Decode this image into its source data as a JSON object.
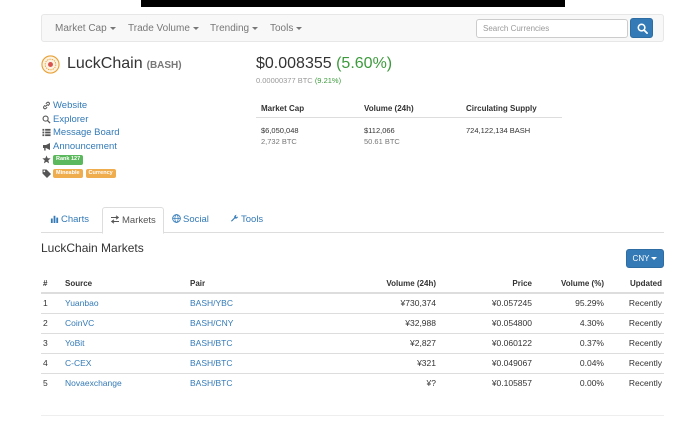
{
  "nav": {
    "items": [
      {
        "label": "Market Cap"
      },
      {
        "label": "Trade Volume"
      },
      {
        "label": "Trending"
      },
      {
        "label": "Tools"
      }
    ],
    "search_placeholder": "Search Currencies",
    "search_icon": "search-icon"
  },
  "coin": {
    "name": "LuckChain",
    "symbol": "(BASH)",
    "logo_icon": "luckchain-logo",
    "price_usd": "$0.008355",
    "change_usd": "(5.60%)",
    "price_btc": "0.00000377 BTC",
    "change_btc": "(9.21%)",
    "change_color": "#3c9a3c"
  },
  "links": {
    "website": "Website",
    "explorer": "Explorer",
    "message_board": "Message Board",
    "announcement": "Announcement",
    "rank": "Rank 127",
    "tags": [
      "Mineable",
      "Currency"
    ]
  },
  "stats": {
    "headers": {
      "market_cap": "Market Cap",
      "volume": "Volume (24h)",
      "supply": "Circulating Supply"
    },
    "market_cap_usd": "$6,050,048",
    "market_cap_btc": "2,732 BTC",
    "volume_usd": "$112,066",
    "volume_btc": "50.61 BTC",
    "supply": "724,122,134 BASH"
  },
  "tabs": [
    {
      "label": "Charts",
      "icon": "bar-chart-icon"
    },
    {
      "label": "Markets",
      "icon": "exchange-arrows-icon",
      "active": true
    },
    {
      "label": "Social",
      "icon": "globe-icon"
    },
    {
      "label": "Tools",
      "icon": "wrench-icon"
    }
  ],
  "markets": {
    "title": "LuckChain Markets",
    "currency": "CNY",
    "columns": [
      "#",
      "Source",
      "Pair",
      "Volume (24h)",
      "Price",
      "Volume (%)",
      "Updated"
    ],
    "rows": [
      [
        "1",
        "Yuanbao",
        "BASH/YBC",
        "¥730,374",
        "¥0.057245",
        "95.29%",
        "Recently"
      ],
      [
        "2",
        "CoinVC",
        "BASH/CNY",
        "¥32,988",
        "¥0.054800",
        "4.30%",
        "Recently"
      ],
      [
        "3",
        "YoBit",
        "BASH/BTC",
        "¥2,827",
        "¥0.060122",
        "0.37%",
        "Recently"
      ],
      [
        "4",
        "C-CEX",
        "BASH/BTC",
        "¥321",
        "¥0.049067",
        "0.04%",
        "Recently"
      ],
      [
        "5",
        "Novaexchange",
        "BASH/BTC",
        "¥?",
        "¥0.105857",
        "0.00%",
        "Recently"
      ]
    ]
  },
  "colors": {
    "link": "#337ab7",
    "primary_button": "#337ab7",
    "tag_green": "#5cb85c",
    "tag_orange": "#f0ad4e"
  }
}
